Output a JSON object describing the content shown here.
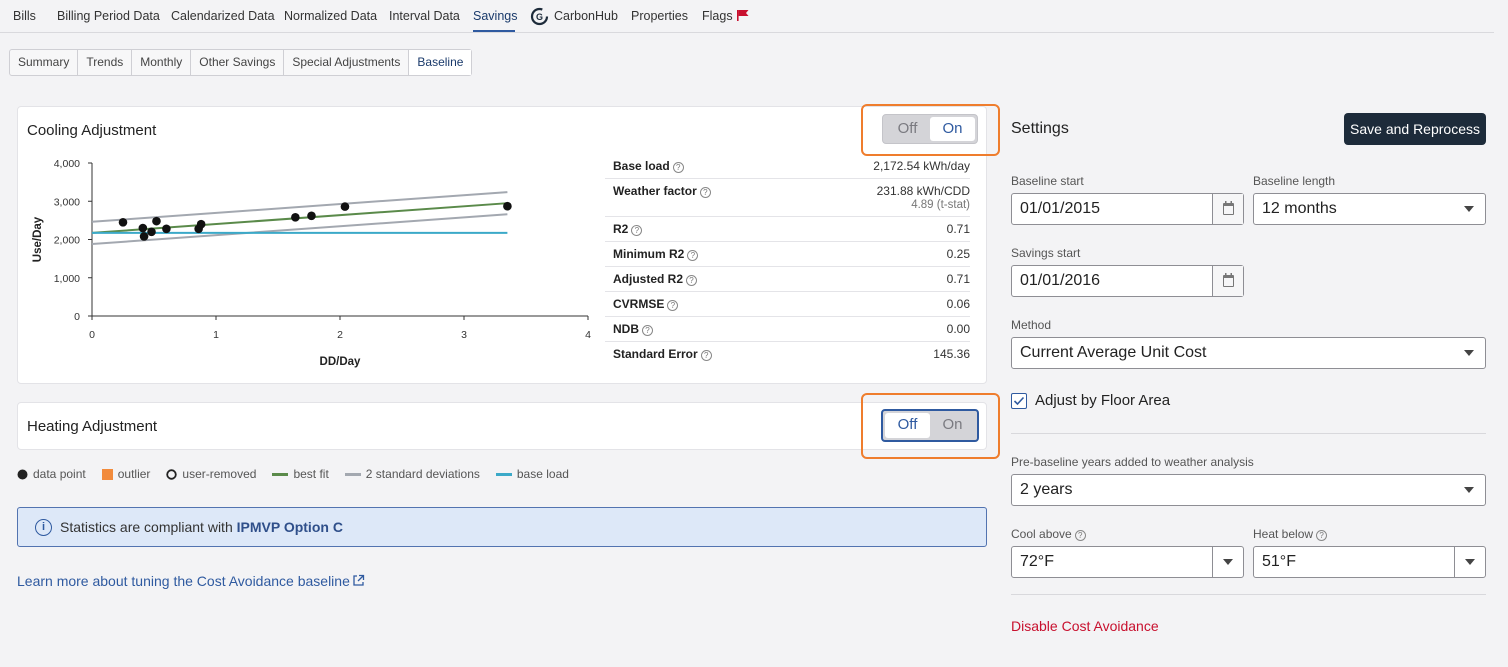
{
  "nav": {
    "tabs": [
      "Bills",
      "Billing Period Data",
      "Calendarized Data",
      "Normalized Data",
      "Interval Data",
      "Savings",
      "CarbonHub",
      "Properties",
      "Flags"
    ],
    "active": "Savings"
  },
  "subtabs": {
    "items": [
      "Summary",
      "Trends",
      "Monthly",
      "Other Savings",
      "Special Adjustments",
      "Baseline"
    ],
    "active": "Baseline"
  },
  "cooling": {
    "title": "Cooling Adjustment",
    "toggle": {
      "off": "Off",
      "on": "On",
      "value": "On"
    },
    "stats": [
      {
        "label": "Base load",
        "value": "2,172.54 kWh/day"
      },
      {
        "label": "Weather factor",
        "value": "231.88 kWh/CDD",
        "sub": "4.89 (t-stat)"
      },
      {
        "label": "R2",
        "value": "0.71"
      },
      {
        "label": "Minimum R2",
        "value": "0.25"
      },
      {
        "label": "Adjusted R2",
        "value": "0.71"
      },
      {
        "label": "CVRMSE",
        "value": "0.06"
      },
      {
        "label": "NDB",
        "value": "0.00"
      },
      {
        "label": "Standard Error",
        "value": "145.36"
      }
    ]
  },
  "heating": {
    "title": "Heating Adjustment",
    "toggle": {
      "off": "Off",
      "on": "On",
      "value": "Off"
    }
  },
  "chart_data": {
    "type": "scatter",
    "xlabel": "DD/Day",
    "ylabel": "Use/Day",
    "xlim": [
      0,
      4
    ],
    "ylim": [
      0,
      4000
    ],
    "xticks": [
      "0",
      "1",
      "2",
      "3",
      "4"
    ],
    "yticks": [
      "0",
      "1,000",
      "2,000",
      "3,000",
      "4,000"
    ],
    "grid": false,
    "points": [
      {
        "x": 0.25,
        "y": 2450
      },
      {
        "x": 0.41,
        "y": 2300
      },
      {
        "x": 0.42,
        "y": 2080
      },
      {
        "x": 0.48,
        "y": 2200
      },
      {
        "x": 0.52,
        "y": 2480
      },
      {
        "x": 0.6,
        "y": 2280
      },
      {
        "x": 0.86,
        "y": 2280
      },
      {
        "x": 0.88,
        "y": 2400
      },
      {
        "x": 1.64,
        "y": 2580
      },
      {
        "x": 1.77,
        "y": 2620
      },
      {
        "x": 2.04,
        "y": 2860
      },
      {
        "x": 3.35,
        "y": 2870
      }
    ],
    "series": [
      {
        "name": "best fit",
        "x": [
          0,
          3.35
        ],
        "y": [
          2172.54,
          2949.34
        ],
        "color": "#5a8a4a"
      },
      {
        "name": "2 standard deviations",
        "x": [
          0,
          3.35
        ],
        "y": [
          2463.26,
          3240.06
        ],
        "color": "#a3a8b0"
      },
      {
        "name": "2 standard deviations",
        "x": [
          0,
          3.35
        ],
        "y": [
          1881.82,
          2658.62
        ],
        "color": "#a3a8b0"
      },
      {
        "name": "base load",
        "x": [
          0,
          3.35
        ],
        "y": [
          2172.54,
          2172.54
        ],
        "color": "#3ba9c8"
      }
    ]
  },
  "legend": {
    "items": [
      {
        "label": "data point",
        "kind": "dot",
        "color": "#222222"
      },
      {
        "label": "outlier",
        "kind": "square",
        "color": "#f28b3c"
      },
      {
        "label": "user-removed",
        "kind": "ring",
        "color": "#222222"
      },
      {
        "label": "best fit",
        "kind": "line",
        "color": "#5a8a4a"
      },
      {
        "label": "2 standard deviations",
        "kind": "line",
        "color": "#a3a8b0"
      },
      {
        "label": "base load",
        "kind": "line",
        "color": "#3ba9c8"
      }
    ]
  },
  "info": {
    "text": "Statistics are compliant with ",
    "highlight": "IPMVP Option C"
  },
  "learn_link": "Learn more about tuning the Cost Avoidance baseline",
  "settings": {
    "title": "Settings",
    "save_label": "Save and Reprocess",
    "baseline_start_label": "Baseline start",
    "baseline_start": "01/01/2015",
    "baseline_length_label": "Baseline length",
    "baseline_length": "12 months",
    "savings_start_label": "Savings start",
    "savings_start": "01/01/2016",
    "method_label": "Method",
    "method": "Current Average Unit Cost",
    "adjust_floor_label": "Adjust by Floor Area",
    "pre_baseline_label": "Pre-baseline years added to weather analysis",
    "pre_baseline": "2 years",
    "cool_above_label": "Cool above",
    "cool_above": "72°F",
    "heat_below_label": "Heat below",
    "heat_below": "51°F",
    "disable_label": "Disable Cost Avoidance"
  },
  "colors": {
    "accent": "#2f5aa0",
    "highlight": "#ef7d2d",
    "danger": "#c8102e",
    "button": "#1d2b3a"
  }
}
